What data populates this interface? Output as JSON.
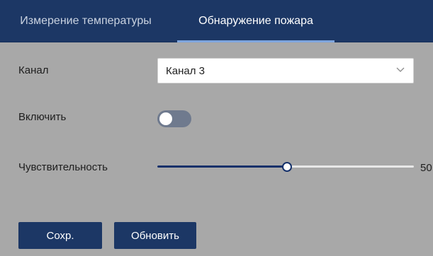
{
  "tabs": [
    {
      "label": "Измерение температуры",
      "active": false
    },
    {
      "label": "Обнаружение пожара",
      "active": true
    }
  ],
  "form": {
    "channel_label": "Канал",
    "channel_value": "Канал 3",
    "enable_label": "Включить",
    "enable_state": false,
    "sensitivity_label": "Чувствительность",
    "sensitivity_value": 50,
    "sensitivity_display": "50"
  },
  "buttons": {
    "save_label": "Сохр.",
    "refresh_label": "Обновить"
  },
  "icons": {
    "channel_dropdown": "chevron-down-icon"
  },
  "colors": {
    "background": "#a8a8a8",
    "header": "#1c3765",
    "accent": "#14306a",
    "active_tab_underline": "#7fa6de",
    "toggle_off": "#6f7a8e"
  }
}
